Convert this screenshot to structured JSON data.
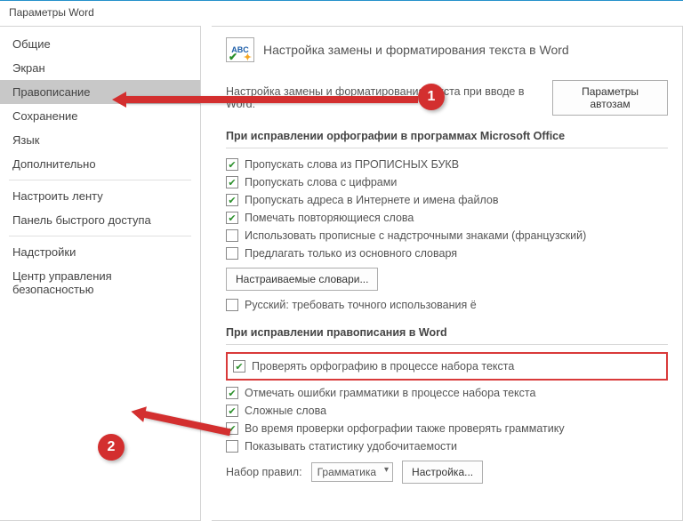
{
  "window": {
    "title": "Параметры Word"
  },
  "sidebar": {
    "items": [
      {
        "label": "Общие"
      },
      {
        "label": "Экран"
      },
      {
        "label": "Правописание"
      },
      {
        "label": "Сохранение"
      },
      {
        "label": "Язык"
      },
      {
        "label": "Дополнительно"
      },
      {
        "label": "Настроить ленту"
      },
      {
        "label": "Панель быстрого доступа"
      },
      {
        "label": "Надстройки"
      },
      {
        "label": "Центр управления безопасностью"
      }
    ]
  },
  "main": {
    "header": "Настройка замены и форматирования текста в Word",
    "autocorrect_row": "Настройка замены и форматирования текста при вводе в Word:",
    "autocorrect_btn": "Параметры автозам",
    "section1": {
      "title": "При исправлении орфографии в программах Microsoft Office",
      "items": [
        {
          "label": "Пропускать слова из ПРОПИСНЫХ БУКВ",
          "checked": true
        },
        {
          "label": "Пропускать слова с цифрами",
          "checked": true
        },
        {
          "label": "Пропускать адреса в Интернете и имена файлов",
          "checked": true
        },
        {
          "label": "Помечать повторяющиеся слова",
          "checked": true
        },
        {
          "label": "Использовать прописные с надстрочными знаками (французский)",
          "checked": false
        },
        {
          "label": "Предлагать только из основного словаря",
          "checked": false
        }
      ],
      "dict_btn": "Настраиваемые словари...",
      "russian": {
        "label": "Русский: требовать точного использования ё",
        "checked": false
      }
    },
    "section2": {
      "title": "При исправлении правописания в Word",
      "highlighted": {
        "label": "Проверять орфографию в процессе набора текста",
        "checked": true
      },
      "items": [
        {
          "label": "Отмечать ошибки грамматики в процессе набора текста",
          "checked": true
        },
        {
          "label": "Сложные слова",
          "checked": true
        },
        {
          "label": "Во время проверки орфографии также проверять грамматику",
          "checked": true
        },
        {
          "label": "Показывать статистику удобочитаемости",
          "checked": false
        }
      ],
      "ruleset_label": "Набор правил:",
      "ruleset_value": "Грамматика",
      "settings_btn": "Настройка..."
    }
  },
  "annotations": {
    "n1": "1",
    "n2": "2"
  }
}
